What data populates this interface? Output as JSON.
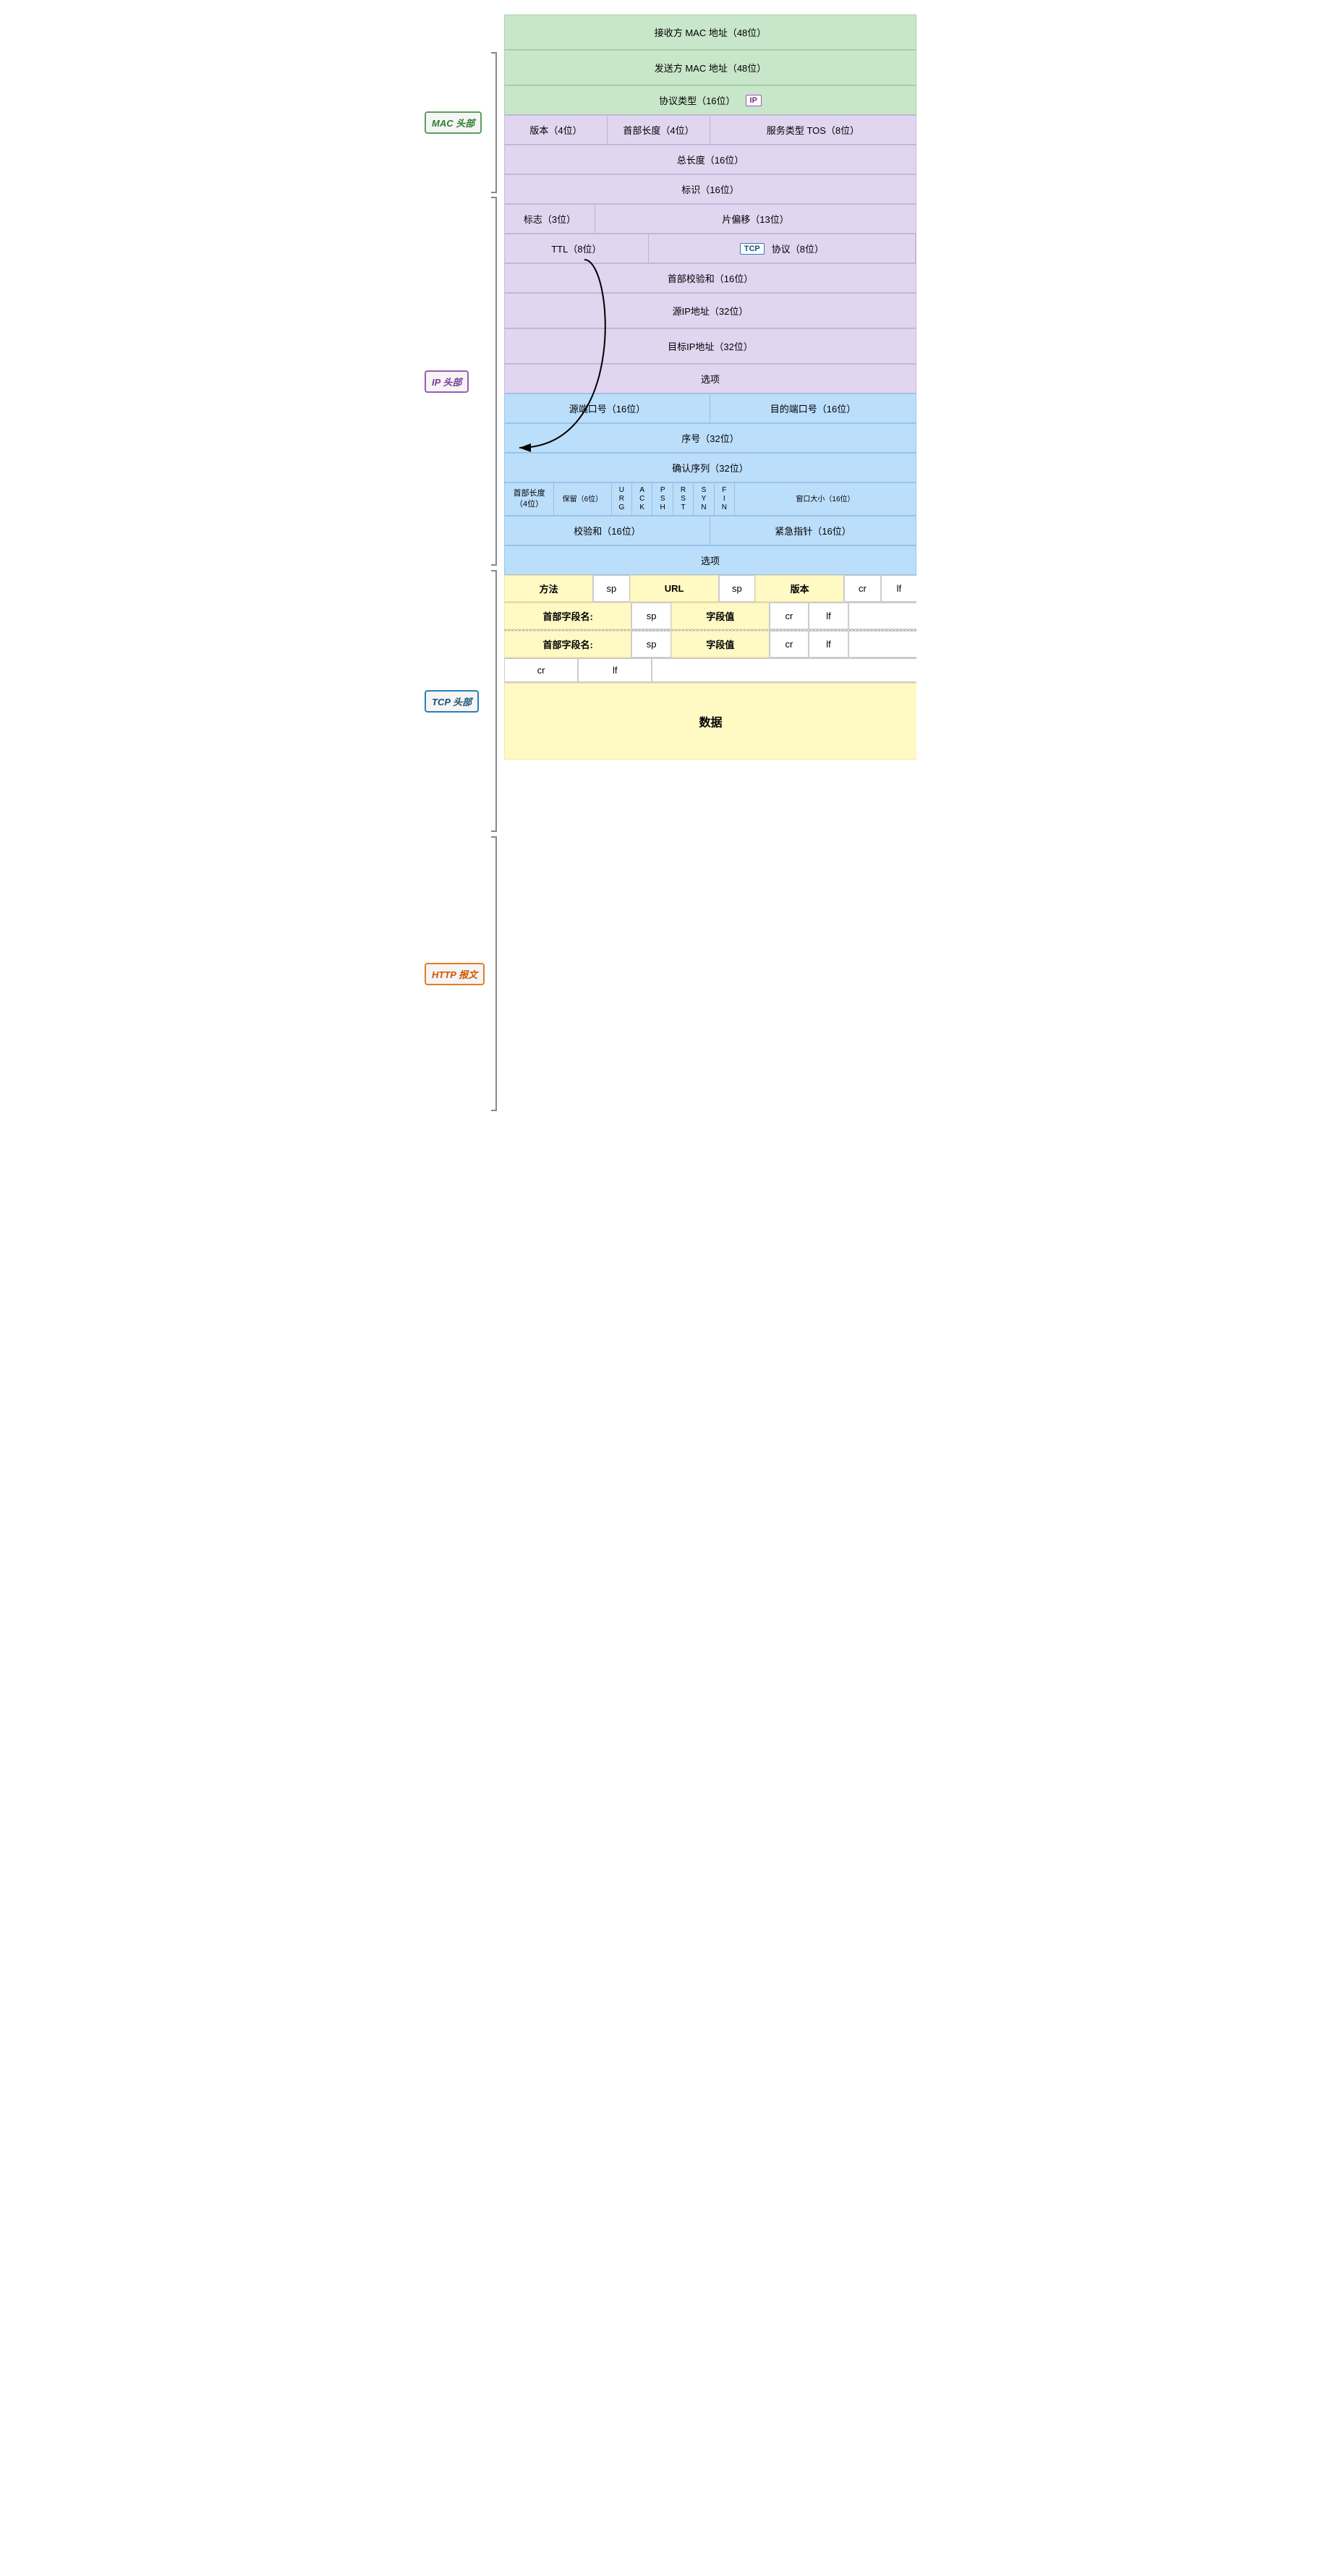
{
  "labels": {
    "mac": "MAC 头部",
    "ip": "IP 头部",
    "tcp": "TCP 头部",
    "http": "HTTP 报文"
  },
  "mac": {
    "dest_mac": "接收方 MAC 地址（48位）",
    "src_mac": "发送方 MAC 地址（48位）",
    "protocol_type": "协议类型（16位）",
    "protocol_tag": "IP"
  },
  "ip": {
    "version": "版本（4位）",
    "header_len": "首部长度（4位）",
    "tos": "服务类型 TOS（8位）",
    "total_len": "总长度（16位）",
    "id": "标识（16位）",
    "flags": "标志（3位）",
    "frag_offset": "片偏移（13位）",
    "ttl": "TTL（8位）",
    "protocol_tag": "TCP",
    "protocol": "协议（8位）",
    "checksum": "首部校验和（16位）",
    "src_ip": "源IP地址（32位）",
    "dst_ip": "目标IP地址（32位）",
    "options": "选项"
  },
  "tcp": {
    "src_port": "源端口号（16位）",
    "dst_port": "目的端口号（16位）",
    "seq": "序号（32位）",
    "ack_seq": "确认序列（32位）",
    "header_len": "首部长度\n（4位）",
    "reserved": "保留（6位）",
    "flag_u": "U",
    "flag_r": "R",
    "flag_g": "G",
    "flag_a": "A",
    "flag_c": "C",
    "flag_k": "K",
    "flag_p": "P",
    "flag_s": "S",
    "flag_h": "H",
    "flag_r2": "R",
    "flag_s2": "S",
    "flag_t": "T",
    "flag_f": "F",
    "flag_i": "I",
    "flag_n2": "N",
    "flag_n": "N",
    "window": "窗口大小（16位）",
    "checksum": "校验和（16位）",
    "urgent": "紧急指针（16位）",
    "options": "选项"
  },
  "http": {
    "method": "方法",
    "sp1": "sp",
    "url": "URL",
    "sp2": "sp",
    "version": "版本",
    "cr1": "cr",
    "lf1": "lf",
    "header_name1": "首部字段名:",
    "sp3": "sp",
    "field_val1": "字段值",
    "cr2": "cr",
    "lf2": "lf",
    "header_name2": "首部字段名:",
    "sp4": "sp",
    "field_val2": "字段值",
    "cr3": "cr",
    "lf3": "lf",
    "cr4": "cr",
    "lf4": "lf",
    "data": "数据"
  }
}
